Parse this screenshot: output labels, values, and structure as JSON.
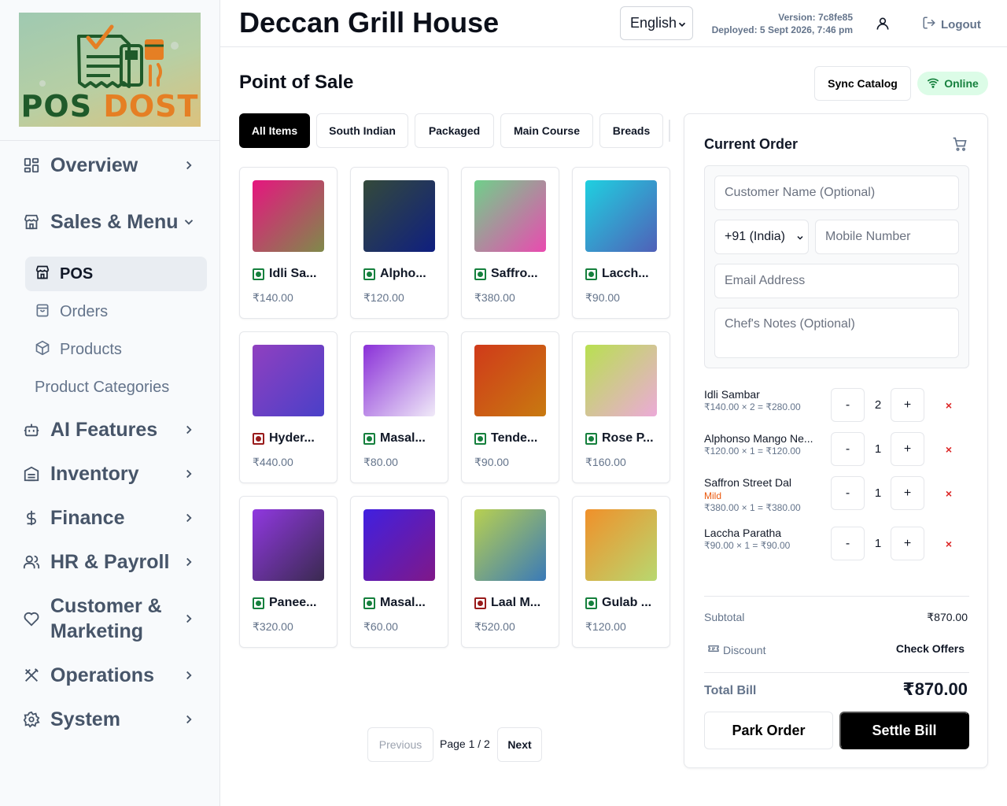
{
  "logo": {
    "part1": "POS",
    "part2": "DOST"
  },
  "sidebar": {
    "items": [
      {
        "label": "Overview",
        "icon": "grid-icon"
      },
      {
        "label": "Sales & Menu",
        "icon": "store-icon",
        "expanded": true,
        "children": [
          {
            "label": "POS",
            "icon": "store-icon",
            "active": true
          },
          {
            "label": "Orders",
            "icon": "bag-icon"
          },
          {
            "label": "Products",
            "icon": "box-icon"
          },
          {
            "label": "Product Categories",
            "icon": ""
          }
        ]
      },
      {
        "label": "AI Features",
        "icon": "bot-icon"
      },
      {
        "label": "Inventory",
        "icon": "warehouse-icon"
      },
      {
        "label": "Finance",
        "icon": "dollar-icon"
      },
      {
        "label": "HR & Payroll",
        "icon": "users-icon"
      },
      {
        "label": "Customer & Marketing",
        "icon": "heart-icon"
      },
      {
        "label": "Operations",
        "icon": "utensils-icon"
      },
      {
        "label": "System",
        "icon": "gear-icon"
      }
    ]
  },
  "header": {
    "title": "Deccan Grill House",
    "language": "English",
    "version": "Version: 7c8fe85",
    "deployed": "Deployed: 5 Sept 2026, 7:46 pm",
    "logout": "Logout"
  },
  "main": {
    "page_title": "Point of Sale",
    "sync_label": "Sync Catalog",
    "status": "Online",
    "categories": [
      "All Items",
      "South Indian",
      "Packaged",
      "Main Course",
      "Breads"
    ],
    "active_category": "All Items",
    "products": [
      {
        "name": "Idli Sa...",
        "price": "₹140.00",
        "veg": true,
        "colors": [
          "#e6157f",
          "#7f8a4a"
        ]
      },
      {
        "name": "Alpho...",
        "price": "₹120.00",
        "veg": true,
        "colors": [
          "#344a3a",
          "#0f1f80"
        ]
      },
      {
        "name": "Saffro...",
        "price": "₹380.00",
        "veg": true,
        "colors": [
          "#6fd08a",
          "#ea4ab0"
        ]
      },
      {
        "name": "Lacch...",
        "price": "₹90.00",
        "veg": true,
        "colors": [
          "#1fd0e0",
          "#5060b8"
        ]
      },
      {
        "name": "Hyder...",
        "price": "₹440.00",
        "veg": false,
        "colors": [
          "#9040c0",
          "#4a40c8"
        ]
      },
      {
        "name": "Masal...",
        "price": "₹80.00",
        "veg": true,
        "colors": [
          "#8a30d8",
          "#f0eaf8"
        ]
      },
      {
        "name": "Tende...",
        "price": "₹90.00",
        "veg": true,
        "colors": [
          "#d03a1a",
          "#c87a10"
        ]
      },
      {
        "name": "Rose P...",
        "price": "₹160.00",
        "veg": true,
        "colors": [
          "#b8e050",
          "#ecaad8"
        ]
      },
      {
        "name": "Panee...",
        "price": "₹320.00",
        "veg": true,
        "colors": [
          "#9038e0",
          "#3a2a50"
        ]
      },
      {
        "name": "Masal...",
        "price": "₹60.00",
        "veg": true,
        "colors": [
          "#4020e0",
          "#801888"
        ]
      },
      {
        "name": "Laal M...",
        "price": "₹520.00",
        "veg": false,
        "colors": [
          "#b8d050",
          "#3a7ab8"
        ]
      },
      {
        "name": "Gulab ...",
        "price": "₹120.00",
        "veg": true,
        "colors": [
          "#f0902a",
          "#b8d870"
        ]
      }
    ],
    "pager": {
      "prev": "Previous",
      "info": "Page 1 / 2",
      "next": "Next"
    }
  },
  "order": {
    "title": "Current Order",
    "customer_placeholder": "Customer Name (Optional)",
    "country_code": "+91 (India)",
    "mobile_placeholder": "Mobile Number",
    "email_placeholder": "Email Address",
    "notes_placeholder": "Chef's Notes (Optional)",
    "lines": [
      {
        "name": "Idli Sambar",
        "variant": "",
        "calc": "₹140.00 × 2 = ₹280.00",
        "qty": "2"
      },
      {
        "name": "Alphonso Mango Ne...",
        "variant": "",
        "calc": "₹120.00 × 1 = ₹120.00",
        "qty": "1"
      },
      {
        "name": "Saffron Street Dal",
        "variant": "Mild",
        "calc": "₹380.00 × 1 = ₹380.00",
        "qty": "1"
      },
      {
        "name": "Laccha Paratha",
        "variant": "",
        "calc": "₹90.00 × 1 = ₹90.00",
        "qty": "1"
      }
    ],
    "minus_label": "-",
    "plus_label": "+",
    "remove_label": "×",
    "subtotal_label": "Subtotal",
    "subtotal_value": "₹870.00",
    "discount_label": "Discount",
    "discount_action": "Check Offers",
    "total_label": "Total Bill",
    "total_value": "₹870.00",
    "park_label": "Park Order",
    "settle_label": "Settle Bill"
  },
  "colors": {
    "accent": "#000000",
    "online_bg": "#dcfce7",
    "online_text": "#15803d",
    "veg": "#15803d",
    "nonveg": "#991b1b",
    "variant": "#ea580c"
  }
}
